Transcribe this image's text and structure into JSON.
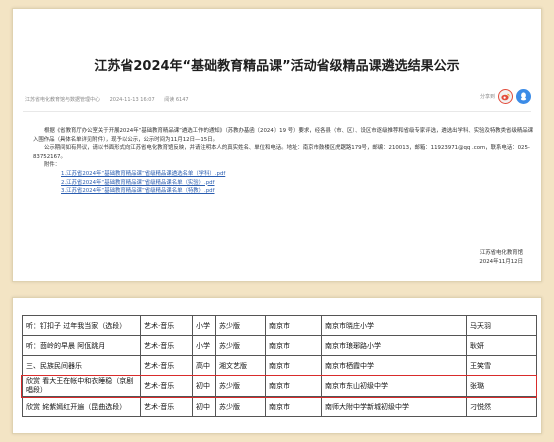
{
  "notice": {
    "title": "江苏省2024年“基础教育精品课”活动省级精品课遴选结果公示",
    "meta": {
      "publisher": "江苏省电化教育馆与数据管理中心",
      "datetime": "2024-11-13 16:07",
      "views": "阅读 6147"
    },
    "share_label": "分享到",
    "share_buttons": [
      "weibo-icon",
      "qq-icon"
    ],
    "paragraphs": [
      "根据《省教育厅办公室关于开展2024年“基础教育精品课”遴选工作的通知》（苏教办基函〔2024〕19 号）要求，经各县（市、区）、设区市逐级推荐和省级专家评选，遴选出学科、实验及特教类省级精品课入围作品（具体名单详见附件），现予以公示，公示时间为11月12日—15日。",
      "公示期间如有异议，请以书面形式向江苏省电化教育馆反映，并请注明本人的真实姓名、单位和电话。地址：南京市鼓楼区虎踞路179号，邮编：210013，邮箱：1192397​1@qq .com，联系电话：025-83752167。"
    ],
    "attachments_label": "附件：",
    "attachments": [
      "1.江苏省2024年“基础教育精品课”省级精品课遴选名单（学科）.pdf",
      "2.江苏省2024年“基础教育精品课”省级精品课名单（实验）.pdf",
      "3.江苏省2024年“基础教育精品课”省级精品课名单（特教）.pdf"
    ],
    "signature": {
      "org": "江苏省电化教育馆",
      "date": "2024年11月12日"
    }
  },
  "roster": {
    "rows": [
      [
        "听：钉扣子  过年我当家（选段）",
        "艺术·音乐",
        "小学",
        "苏少版",
        "南京市",
        "南京市晓庄小学",
        "马天羽"
      ],
      [
        "听：茴岭的早晨  阿佤跳月",
        "艺术·音乐",
        "小学",
        "苏少版",
        "南京市",
        "南京市琅琊路小学",
        "耿妍"
      ],
      [
        "三、民族民间器乐",
        "艺术·音乐",
        "高中",
        "湘文艺版",
        "南京市",
        "南京市栖霞中学",
        "王笑雪"
      ],
      [
        "欣赏  看大王在帐中和衣睡稳（京剧唱段）",
        "艺术·音乐",
        "初中",
        "苏少版",
        "南京市",
        "南京市东山初级中学",
        "张璐"
      ],
      [
        "欣赏  姹紫嫣红开遍（昆曲选段）",
        "艺术·音乐",
        "初中",
        "苏少版",
        "南京市",
        "南师大附中学新城初级中学",
        "刁悦然"
      ]
    ],
    "highlighted_row_index": 3,
    "highlight_color": "#d82c2c"
  }
}
